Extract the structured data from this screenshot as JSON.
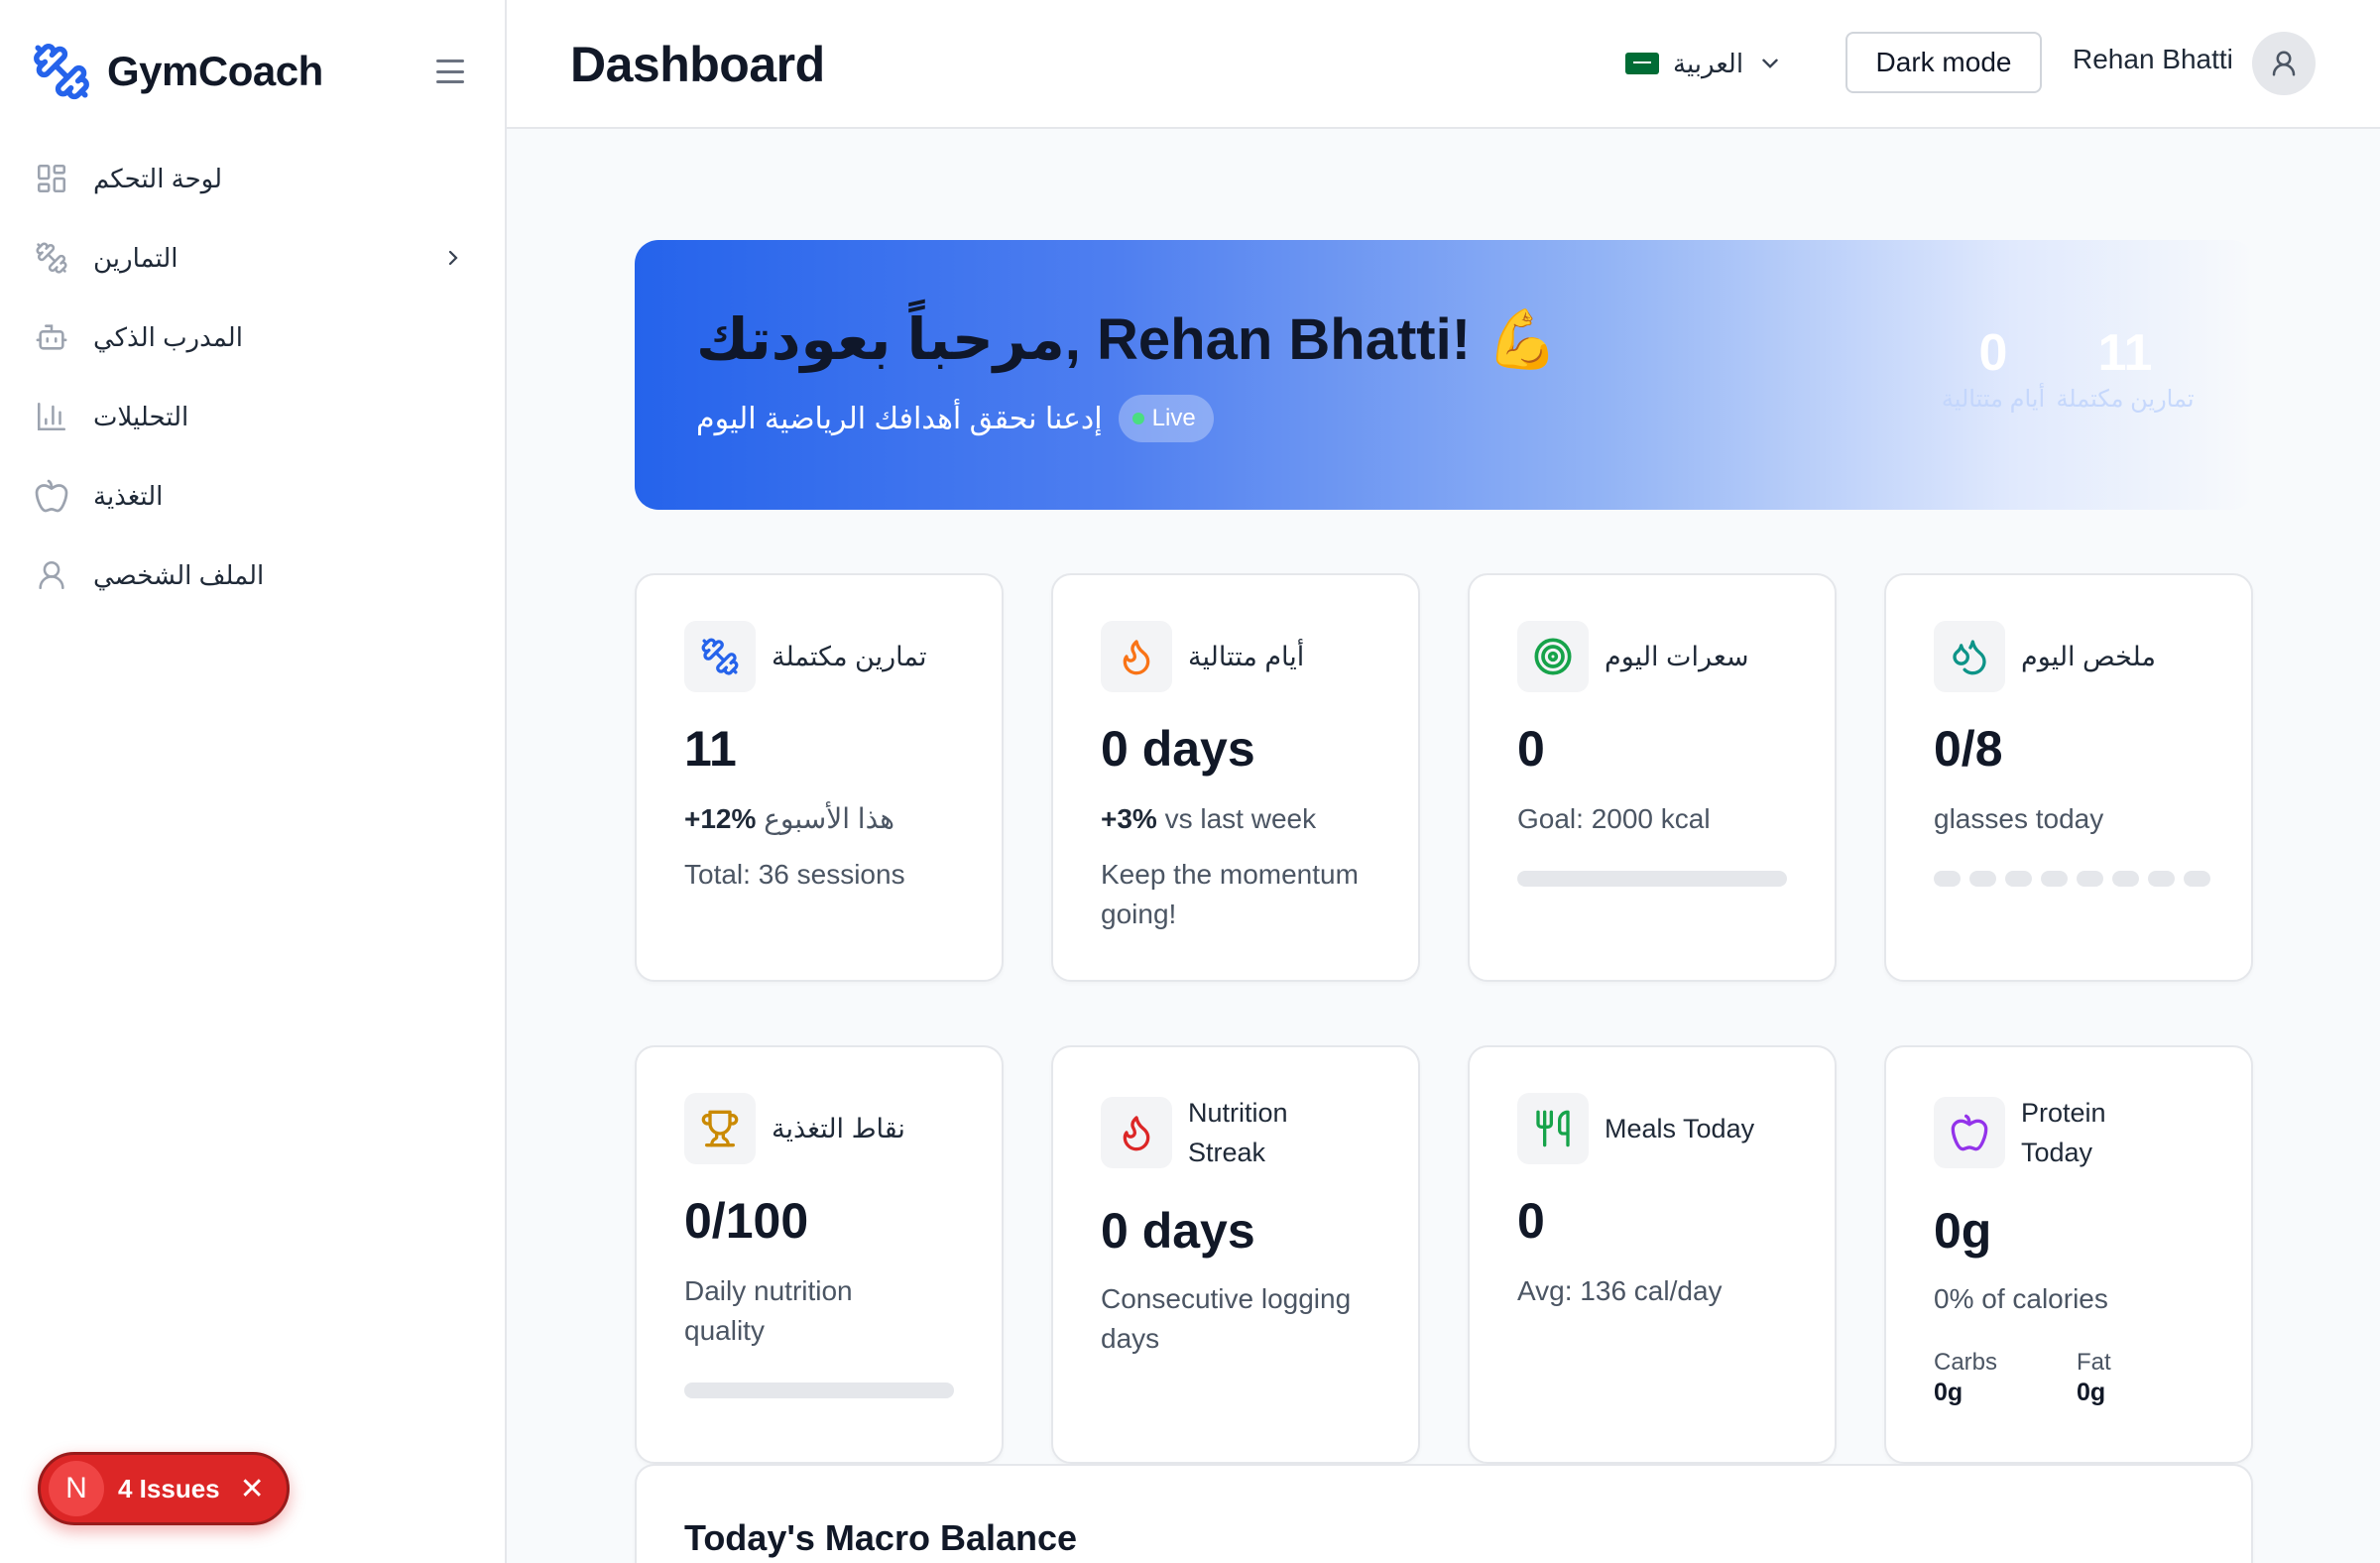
{
  "app": {
    "name": "GymCoach"
  },
  "sidebar": {
    "items": [
      {
        "label": "لوحة التحكم",
        "icon": "grid-icon"
      },
      {
        "label": "التمارين",
        "icon": "dumbbell-icon"
      },
      {
        "label": "المدرب الذكي",
        "icon": "bot-icon"
      },
      {
        "label": "التحليلات",
        "icon": "bar-chart-icon"
      },
      {
        "label": "التغذية",
        "icon": "apple-icon"
      },
      {
        "label": "الملف الشخصي",
        "icon": "user-icon"
      }
    ]
  },
  "issues": {
    "letter": "N",
    "label": "4 Issues"
  },
  "header": {
    "title": "Dashboard",
    "language": "العربية",
    "dark_mode": "Dark mode",
    "user_name": "Rehan Bhatti"
  },
  "banner": {
    "welcome": "مرحباً بعودتك, Rehan Bhatti! 💪",
    "subtitle": "إدعنا نحقق أهدافك الرياضية اليوم",
    "live": "Live",
    "stats": [
      {
        "value": "0",
        "label": "أيام متتالية"
      },
      {
        "value": "11",
        "label": "تمارين مكتملة"
      }
    ]
  },
  "cards": {
    "workouts": {
      "title": "تمارين مكتملة",
      "value": "11",
      "delta": "+12%",
      "delta_text": "هذا الأسبوع",
      "line2": "Total: 36 sessions"
    },
    "streak": {
      "title": "أيام متتالية",
      "value": "0 days",
      "delta": "+3%",
      "delta_text": "vs last week",
      "line2": "Keep the momentum going!"
    },
    "calories": {
      "title": "سعرات اليوم",
      "value": "0",
      "line1": "Goal: 2000 kcal",
      "progress": 0
    },
    "water": {
      "title": "ملخص اليوم",
      "value": "0/8",
      "line1": "glasses today",
      "glasses_filled": 0,
      "glasses_total": 8
    },
    "nutrition_points": {
      "title": "نقاط التغذية",
      "value": "0/100",
      "line1": "Daily nutrition quality",
      "progress": 0
    },
    "nutrition_streak": {
      "title": "Nutrition Streak",
      "value": "0 days",
      "line1": "Consecutive logging days"
    },
    "meals": {
      "title": "Meals Today",
      "value": "0",
      "line1": "Avg: 136 cal/day"
    },
    "protein": {
      "title": "Protein Today",
      "value": "0g",
      "line1": "0% of calories",
      "carbs_label": "Carbs",
      "carbs_value": "0g",
      "fat_label": "Fat",
      "fat_value": "0g"
    }
  },
  "macro_section": {
    "title": "Today's Macro Balance"
  },
  "colors": {
    "brand": "#2563eb",
    "danger": "#dc2626",
    "success": "#4ade80"
  }
}
